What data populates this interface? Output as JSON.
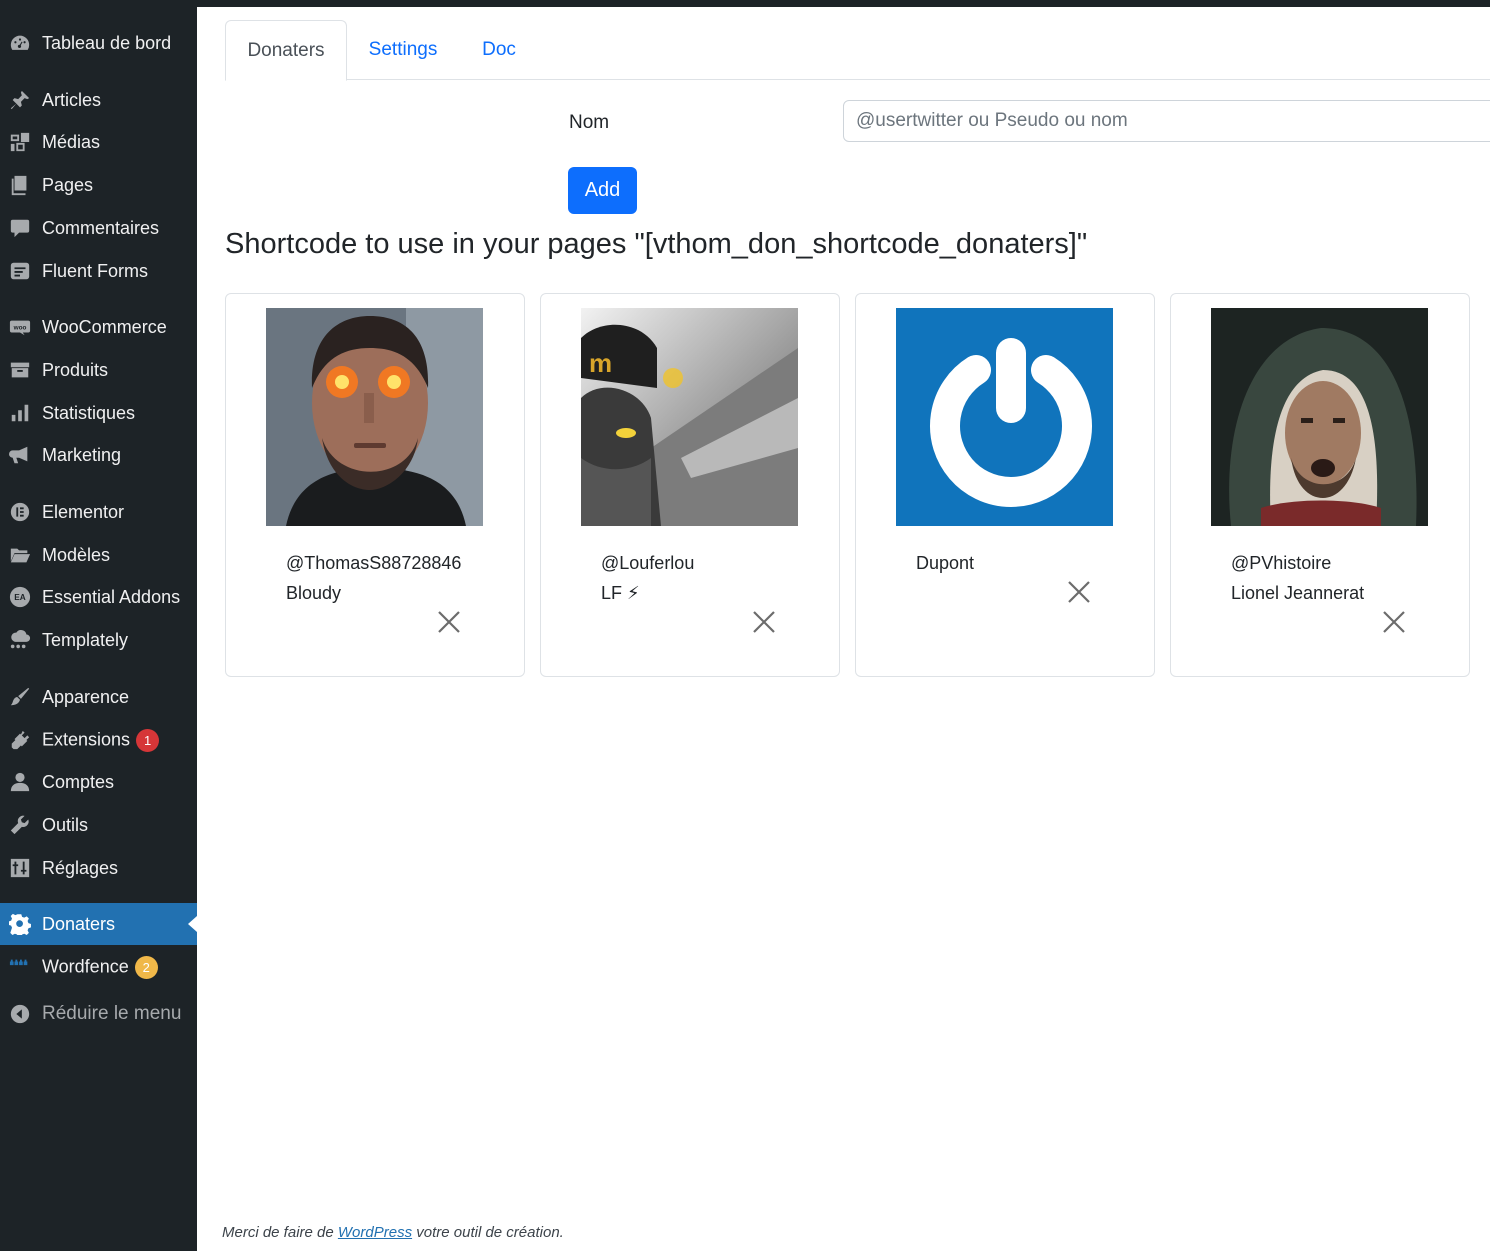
{
  "sidebar": {
    "items": [
      {
        "label": "Tableau de bord",
        "icon": "dashboard-icon"
      },
      {
        "label": "Articles",
        "icon": "pin-icon"
      },
      {
        "label": "Médias",
        "icon": "media-icon"
      },
      {
        "label": "Pages",
        "icon": "pages-icon"
      },
      {
        "label": "Commentaires",
        "icon": "comment-icon"
      },
      {
        "label": "Fluent Forms",
        "icon": "forms-icon"
      },
      {
        "label": "WooCommerce",
        "icon": "woo-icon"
      },
      {
        "label": "Produits",
        "icon": "archive-icon"
      },
      {
        "label": "Statistiques",
        "icon": "bar-chart-icon"
      },
      {
        "label": "Marketing",
        "icon": "megaphone-icon"
      },
      {
        "label": "Elementor",
        "icon": "elementor-icon"
      },
      {
        "label": "Modèles",
        "icon": "folder-icon"
      },
      {
        "label": "Essential Addons",
        "icon": "essential-addons-icon"
      },
      {
        "label": "Templately",
        "icon": "templately-icon"
      },
      {
        "label": "Apparence",
        "icon": "brush-icon"
      },
      {
        "label": "Extensions",
        "icon": "plugin-icon",
        "badge": "1"
      },
      {
        "label": "Comptes",
        "icon": "user-icon"
      },
      {
        "label": "Outils",
        "icon": "wrench-icon"
      },
      {
        "label": "Réglages",
        "icon": "settings-sliders-icon"
      },
      {
        "label": "Donaters",
        "icon": "gear-icon",
        "active": true
      },
      {
        "label": "Wordfence",
        "icon": "wordfence-icon",
        "badge": "2"
      },
      {
        "label": "Réduire le menu",
        "icon": "collapse-icon"
      }
    ],
    "active_color": "#2271b1",
    "background": "#1d2327"
  },
  "tabs": [
    {
      "label": "Donaters",
      "active": true
    },
    {
      "label": "Settings"
    },
    {
      "label": "Doc"
    }
  ],
  "form": {
    "label": "Nom",
    "placeholder": "@usertwitter ou Pseudo ou nom",
    "value": "",
    "add_label": "Add"
  },
  "shortcode_text": "Shortcode to use in your pages \"[vthom_don_shortcode_donaters]\"",
  "donaters": [
    {
      "line1": "@ThomasS88728846",
      "line2": "Bloudy",
      "avatar": "avatar-photo-red-eyes"
    },
    {
      "line1": "@Louferlou",
      "line2": "LF ⚡",
      "avatar": "avatar-photo-cap"
    },
    {
      "line1": "Dupont",
      "line2": "",
      "avatar": "gravatar-logo"
    },
    {
      "line1": "@PVhistoire",
      "line2": "Lionel Jeannerat",
      "avatar": "avatar-photo-hood"
    }
  ],
  "footer": {
    "before": "Merci de faire de ",
    "link": "WordPress",
    "after": " votre outil de création."
  }
}
